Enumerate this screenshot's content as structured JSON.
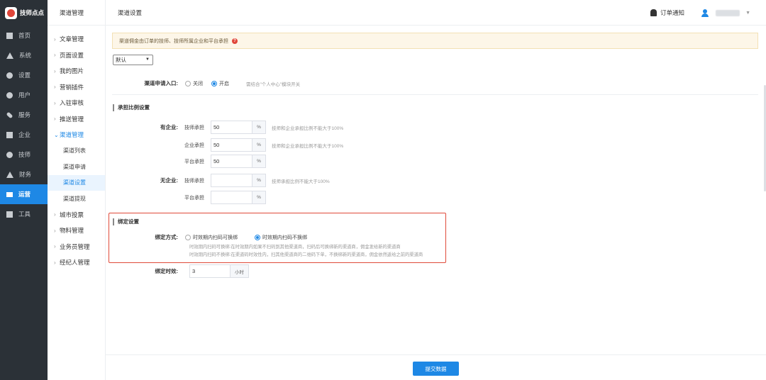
{
  "app": {
    "name": "技师点点"
  },
  "sidebar": {
    "items": [
      {
        "label": "首页",
        "icon": "monitor-icon"
      },
      {
        "label": "系统",
        "icon": "hierarchy-icon"
      },
      {
        "label": "设置",
        "icon": "gear-icon"
      },
      {
        "label": "用户",
        "icon": "user-icon"
      },
      {
        "label": "服务",
        "icon": "link-icon"
      },
      {
        "label": "企业",
        "icon": "building-icon"
      },
      {
        "label": "技师",
        "icon": "person-icon"
      },
      {
        "label": "财务",
        "icon": "finance-icon"
      },
      {
        "label": "运营",
        "icon": "chart-icon"
      },
      {
        "label": "工具",
        "icon": "toolbox-icon"
      }
    ]
  },
  "menu2": {
    "title": "渠道管理",
    "items": [
      "文章管理",
      "页面设置",
      "我的图片",
      "营销插件",
      "入驻审核",
      "推送管理",
      "渠道管理"
    ],
    "sub_items": [
      "渠道列表",
      "渠道申请",
      "渠道设置",
      "渠道提现"
    ],
    "items_after": [
      "城市投票",
      "物料管理",
      "业务员管理",
      "经纪人管理"
    ]
  },
  "topbar": {
    "title": "渠道设置",
    "notify": "订单通知"
  },
  "notice": {
    "text": "渠道佣金由订单的技师、技师所属企业和平台承担"
  },
  "select": {
    "value": "默认"
  },
  "apply_entry": {
    "label": "渠道申请入口:",
    "options": [
      "关闭",
      "开启"
    ],
    "hint": "需结合\"个人中心\"模块开关"
  },
  "ratio_section": {
    "title": "承担比例设置",
    "with_company_label": "有企业:",
    "without_company_label": "无企业:",
    "with_rows": [
      {
        "label": "技师承担",
        "value": "50",
        "unit": "%",
        "hint": "技师和企业承担比例不能大于100%"
      },
      {
        "label": "企业承担",
        "value": "50",
        "unit": "%",
        "hint": "技师和企业承担比例不能大于100%"
      },
      {
        "label": "平台承担",
        "value": "50",
        "unit": "%",
        "hint": ""
      }
    ],
    "without_rows": [
      {
        "label": "技师承担",
        "value": "",
        "unit": "%",
        "hint": "技师承担比例不能大于100%"
      },
      {
        "label": "平台承担",
        "value": "",
        "unit": "%",
        "hint": ""
      }
    ]
  },
  "bind_section": {
    "title": "绑定设置",
    "mode_label": "绑定方式:",
    "options": [
      "时效期内扫码可换绑",
      "时效期内扫码不换绑"
    ],
    "desc1": "时效期内扫码可换绑:在时效期内如果不扫码到其他渠道商，扫码后可换绑新的渠道商，佣金发给新的渠道商",
    "desc2": "时效期内扫码不换绑:在渠道码时效性内，扫其他渠道商的二维码下单，不换绑新的渠道商，佣金依然返给之前的渠道商",
    "duration_label": "绑定时效:",
    "duration_value": "3",
    "duration_unit": "小时"
  },
  "footer": {
    "submit": "提交数据"
  }
}
